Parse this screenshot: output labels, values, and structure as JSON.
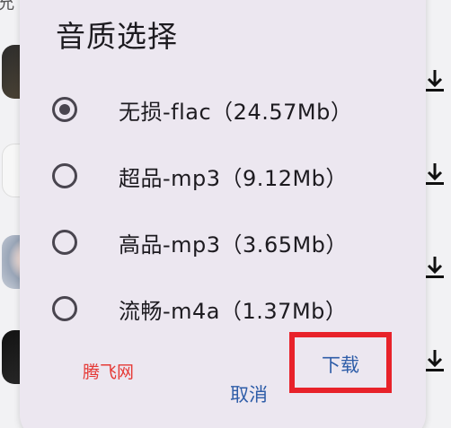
{
  "background": {
    "top_text": "允",
    "download_icon": "download-arrow-icon"
  },
  "dialog": {
    "title": "音质选择",
    "options": [
      {
        "label": "无损-flac（24.57Mb）",
        "selected": true
      },
      {
        "label": "超品-mp3（9.12Mb）",
        "selected": false
      },
      {
        "label": "高品-mp3（3.65Mb）",
        "selected": false
      },
      {
        "label": "流畅-m4a（1.37Mb）",
        "selected": false
      }
    ],
    "watermark": "腾飞网",
    "cancel_label": "取消",
    "download_label": "下载"
  },
  "colors": {
    "dialog_bg": "#ece7f0",
    "button_text": "#2e5da8",
    "highlight_box": "#e8222a",
    "watermark": "#e53935"
  }
}
